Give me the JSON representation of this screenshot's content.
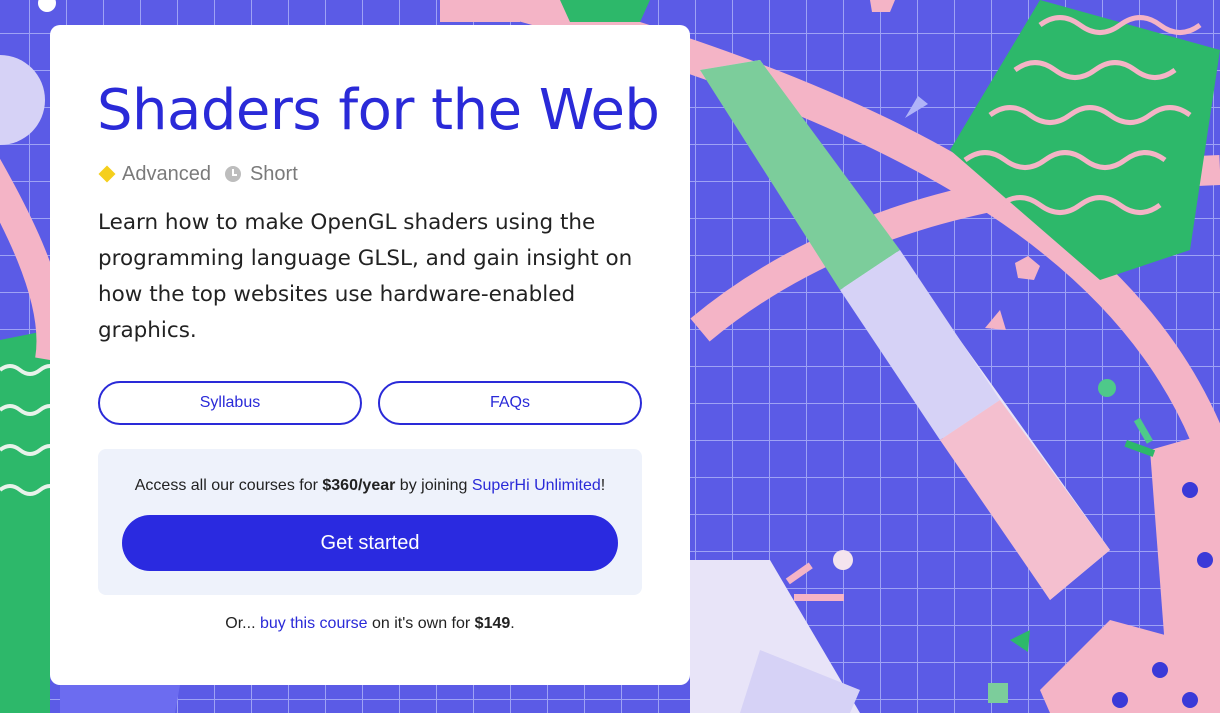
{
  "course": {
    "title": "Shaders for the Web",
    "level": "Advanced",
    "length": "Short",
    "description": "Learn how to make OpenGL shaders using the programming language GLSL, and gain insight on how the top websites use hardware-enabled graphics.",
    "level_icon": "diamond-icon",
    "length_icon": "clock-icon"
  },
  "buttons": {
    "syllabus": "Syllabus",
    "faqs": "FAQs"
  },
  "promo": {
    "text_before": "Access all our courses for ",
    "price": "$360/year",
    "text_middle": " by joining ",
    "link": "SuperHi Unlimited",
    "text_after": "!",
    "cta": "Get started"
  },
  "footnote": {
    "before": "Or... ",
    "link": "buy this course",
    "middle": " on it's own for ",
    "price": "$149",
    "after": "."
  },
  "colors": {
    "accent": "#2a2ad8",
    "background": "#5b5be6",
    "level_badge": "#f5cf1c",
    "promo_bg": "#eef2fb"
  }
}
